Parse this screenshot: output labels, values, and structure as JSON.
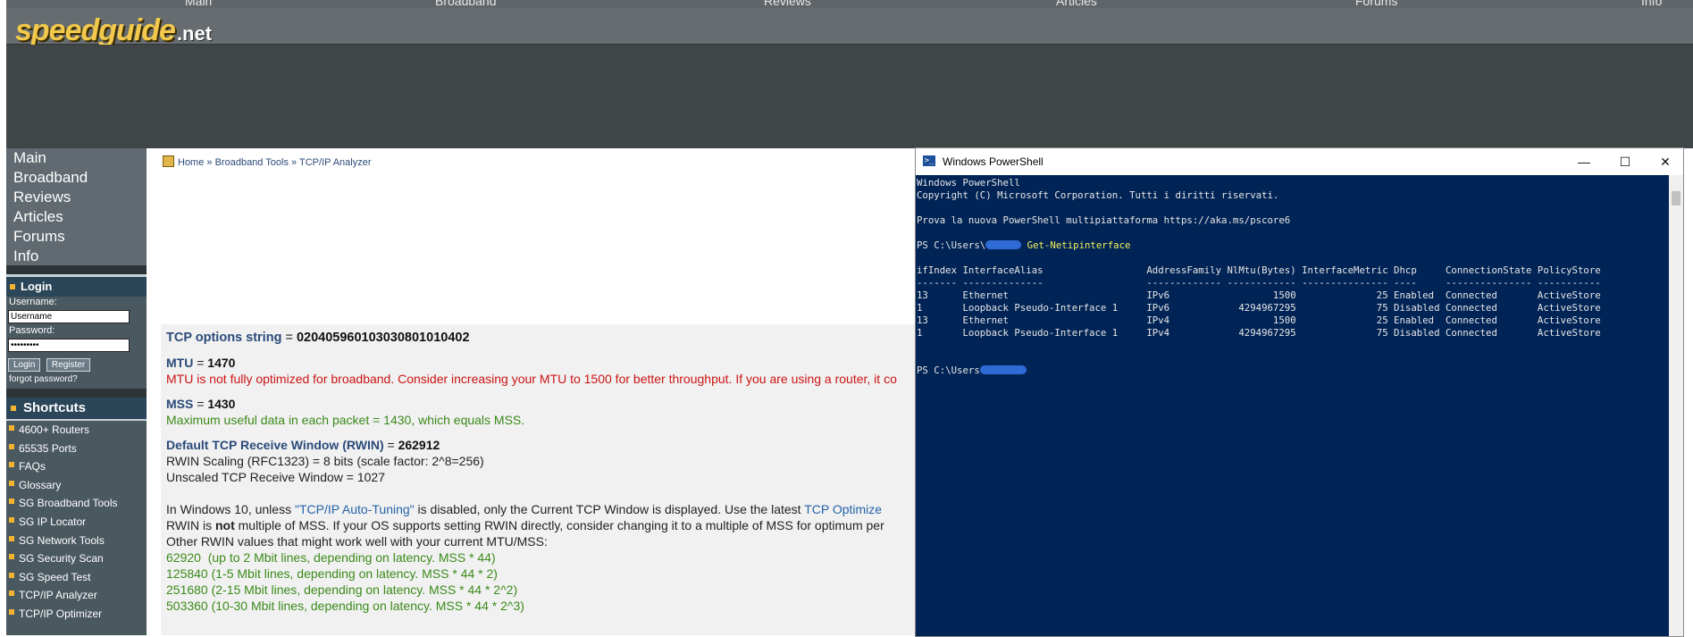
{
  "site": {
    "logo_main": "speedguide",
    "logo_tld": ".net",
    "top_nav": [
      "Main",
      "Broadband",
      "Reviews",
      "Articles",
      "Forums",
      "Info"
    ]
  },
  "sidebar": {
    "main_nav": [
      "Main",
      "Broadband",
      "Reviews",
      "Articles",
      "Forums",
      "Info"
    ],
    "login": {
      "title": "Login",
      "username_label": "Username:",
      "username_value": "Username",
      "password_label": "Password:",
      "password_value": "password1",
      "login_button": "Login",
      "register_button": "Register",
      "forgot": "forgot password?"
    },
    "shortcuts_title": "Shortcuts",
    "shortcuts": [
      "4600+ Routers",
      "65535 Ports",
      "FAQs",
      "Glossary",
      "SG Broadband Tools",
      "SG IP Locator",
      "SG Network Tools",
      "SG Security Scan",
      "SG Speed Test",
      "TCP/IP Analyzer",
      "TCP/IP Optimizer"
    ]
  },
  "breadcrumb": {
    "home": "Home",
    "sep": "»",
    "tools": "Broadband Tools",
    "current": "TCP/IP Analyzer"
  },
  "results": {
    "tcp_options_label": "TCP options string",
    "tcp_options_value": "020405960103030801010402",
    "mtu_label": "MTU",
    "mtu_value": "1470",
    "mtu_note": "MTU is not fully optimized for broadband. Consider increasing your MTU to 1500 for better throughput. If you are using a router, it co",
    "mss_label": "MSS",
    "mss_value": "1430",
    "mss_note": "Maximum useful data in each packet = 1430, which equals MSS.",
    "rwin_label": "Default TCP Receive Window (RWIN)",
    "rwin_value": "262912",
    "rwin_scaling": "RWIN Scaling (RFC1323) = 8 bits (scale factor: 2^8=256)",
    "unscaled": "Unscaled TCP Receive Window = 1027",
    "win10_a": "In Windows 10, unless ",
    "win10_link": "\"TCP/IP Auto-Tuning\"",
    "win10_b": " is disabled, only the Current TCP Window is displayed. Use the latest ",
    "win10_link2": "TCP Optimize",
    "rwin_not_a": "RWIN is ",
    "rwin_not_b": "not",
    "rwin_not_c": " multiple of MSS. If your OS supports setting RWIN directly, consider changing it to a multiple of MSS for optimum per",
    "other_rwin": "Other RWIN values that might work well with your current MTU/MSS:",
    "rwin_values": [
      "62920  (up to 2 Mbit lines, depending on latency. MSS * 44)",
      "125840 (1-5 Mbit lines, depending on latency. MSS * 44 * 2)",
      "251680 (2-15 Mbit lines, depending on latency. MSS * 44 * 2^2)",
      "503360 (10-30 Mbit lines, depending on latency. MSS * 44 * 2^3)"
    ]
  },
  "powershell": {
    "title": "Windows PowerShell",
    "icon_glyph": ">_",
    "minimize": "—",
    "maximize": "☐",
    "close": "✕",
    "line1": "Windows PowerShell",
    "line2": "Copyright (C) Microsoft Corporation. Tutti i diritti riservati.",
    "line3": "Prova la nuova PowerShell multipiattaforma https://aka.ms/pscore6",
    "prompt1": "PS C:\\Users\\",
    "command": "Get-Netipinterface",
    "table_header": "ifIndex InterfaceAlias                  AddressFamily NlMtu(Bytes) InterfaceMetric Dhcp     ConnectionState PolicyStore",
    "table_rule": "------- --------------                  ------------- ------------ --------------- ----     --------------- -----------",
    "rows": [
      "13      Ethernet                        IPv6                  1500              25 Enabled  Connected       ActiveStore",
      "1       Loopback Pseudo-Interface 1     IPv6            4294967295              75 Disabled Connected       ActiveStore",
      "13      Ethernet                        IPv4                  1500              25 Enabled  Connected       ActiveStore",
      "1       Loopback Pseudo-Interface 1     IPv4            4294967295              75 Disabled Connected       ActiveStore"
    ],
    "prompt2": "PS C:\\Users"
  }
}
